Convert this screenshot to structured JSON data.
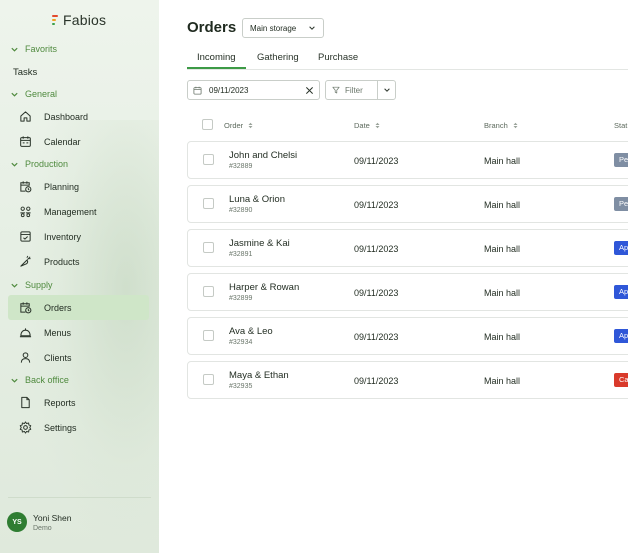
{
  "app": {
    "name": "Fabios"
  },
  "sidebar": {
    "sections": [
      {
        "label": "Favorits"
      },
      {
        "label": "General"
      },
      {
        "label": "Production"
      },
      {
        "label": "Supply"
      },
      {
        "label": "Back office"
      }
    ],
    "favorites": [
      {
        "label": "Tasks"
      }
    ],
    "general": [
      {
        "label": "Dashboard",
        "icon": "home-icon"
      },
      {
        "label": "Calendar",
        "icon": "calendar-icon"
      }
    ],
    "production": [
      {
        "label": "Planning",
        "icon": "calendar-clock-icon"
      },
      {
        "label": "Management",
        "icon": "users-icon"
      },
      {
        "label": "Inventory",
        "icon": "box-check-icon"
      },
      {
        "label": "Products",
        "icon": "carrot-icon"
      }
    ],
    "supply": [
      {
        "label": "Orders",
        "icon": "calendar-clock-icon",
        "active": true
      },
      {
        "label": "Menus",
        "icon": "cloche-icon"
      },
      {
        "label": "Clients",
        "icon": "user-icon"
      }
    ],
    "backoffice": [
      {
        "label": "Reports",
        "icon": "file-icon"
      },
      {
        "label": "Settings",
        "icon": "gear-icon"
      }
    ],
    "user": {
      "initials": "YS",
      "name": "Yoni Shen",
      "role": "Demo"
    }
  },
  "main": {
    "title": "Orders",
    "storage_select": {
      "value": "Main storage"
    },
    "tabs": [
      {
        "label": "Incoming",
        "active": true
      },
      {
        "label": "Gathering"
      },
      {
        "label": "Purchase"
      }
    ],
    "date_filter": {
      "value": "09/11/2023"
    },
    "filter_label": "Filter",
    "columns": [
      {
        "label": "Order"
      },
      {
        "label": "Date"
      },
      {
        "label": "Branch"
      },
      {
        "label": "Stat"
      }
    ],
    "rows": [
      {
        "name": "John and Chelsi",
        "number": "#32889",
        "date": "09/11/2023",
        "branch": "Main hall",
        "status": "Pe",
        "status_color": "#7f8ea3"
      },
      {
        "name": "Luna & Orion",
        "number": "#32890",
        "date": "09/11/2023",
        "branch": "Main hall",
        "status": "Pe",
        "status_color": "#7f8ea3"
      },
      {
        "name": "Jasmine & Kai",
        "number": "#32891",
        "date": "09/11/2023",
        "branch": "Main hall",
        "status": "Ap",
        "status_color": "#2f57d8"
      },
      {
        "name": "Harper & Rowan",
        "number": "#32899",
        "date": "09/11/2023",
        "branch": "Main hall",
        "status": "Ap",
        "status_color": "#2f57d8"
      },
      {
        "name": "Ava & Leo",
        "number": "#32934",
        "date": "09/11/2023",
        "branch": "Main hall",
        "status": "Ap",
        "status_color": "#2f57d8"
      },
      {
        "name": "Maya & Ethan",
        "number": "#32935",
        "date": "09/11/2023",
        "branch": "Main hall",
        "status": "Ca",
        "status_color": "#d93a2b"
      }
    ]
  },
  "colors": {
    "accent": "#3d9a46",
    "section_text": "#4f8a3e",
    "active_item_bg": "#cfe6c8"
  }
}
